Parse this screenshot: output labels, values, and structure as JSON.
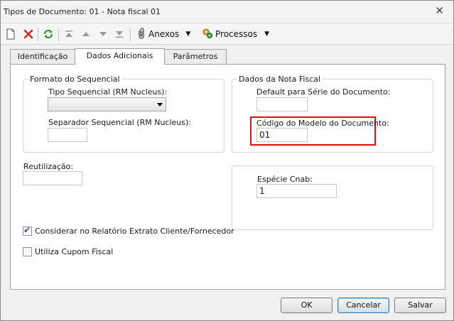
{
  "window": {
    "title": "Tipos de Documento: 01 - Nota fiscal 01",
    "close_glyph": "✕"
  },
  "toolbar": {
    "new_icon": "new-document-icon",
    "delete_icon": "delete-icon",
    "refresh_icon": "refresh-icon",
    "first_icon": "first-record-icon",
    "prev_icon": "previous-record-icon",
    "next_icon": "next-record-icon",
    "last_icon": "last-record-icon",
    "anexos_label": "Anexos",
    "processos_label": "Processos",
    "caret": "▼"
  },
  "tabs": [
    {
      "label": "Identificação",
      "active": false
    },
    {
      "label": "Dados Adicionais",
      "active": true
    },
    {
      "label": "Parâmetros",
      "active": false
    }
  ],
  "formato": {
    "title": "Formato do Sequencial",
    "tipo_label": "Tipo Sequencial (RM Nucleus):",
    "tipo_value": "",
    "separador_label": "Separador Sequencial (RM Nucleus):",
    "separador_value": ""
  },
  "nota": {
    "title": "Dados da Nota Fiscal",
    "default_serie_label": "Default para Série do Documento:",
    "default_serie_value": "",
    "codigo_modelo_label": "Código do Modelo do Documento:",
    "codigo_modelo_value": "01"
  },
  "reutilizacao": {
    "label": "Reutilização:",
    "value": ""
  },
  "especie": {
    "label": "Espécie Cnab:",
    "value": "1"
  },
  "checkboxes": [
    {
      "label": "Considerar no Relatório Extrato Cliente/Fornecedor",
      "checked": true
    },
    {
      "label": "Utiliza Cupom Fiscal",
      "checked": false
    }
  ],
  "buttons": {
    "ok": "OK",
    "cancelar": "Cancelar",
    "salvar": "Salvar"
  },
  "colors": {
    "highlight": "#e01010",
    "delete_red": "#d42020",
    "refresh_green": "#2c9a2c"
  },
  "checkmark": "✔"
}
